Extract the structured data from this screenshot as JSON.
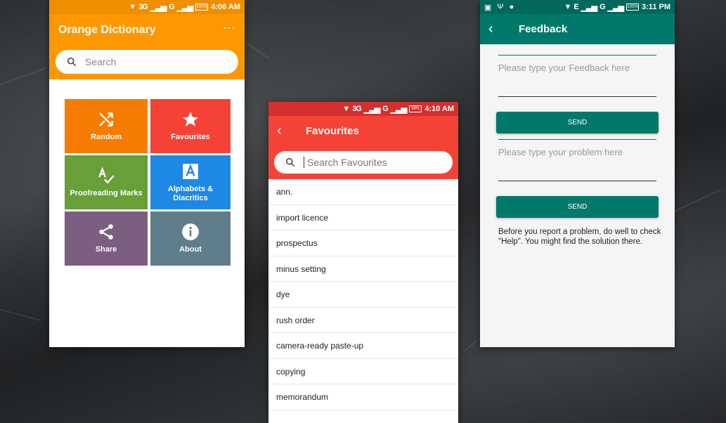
{
  "phone1": {
    "status": {
      "network": "3G",
      "network2": "G",
      "battery": "100%",
      "time": "4:06 AM"
    },
    "title": "Orange Dictionary",
    "search_placeholder": "Search",
    "tiles": [
      {
        "label": "Random",
        "color": "#f57c00",
        "icon": "shuffle-icon"
      },
      {
        "label": "Favourites",
        "color": "#f44336",
        "icon": "star-icon"
      },
      {
        "label": "Proofreading Marks",
        "color": "#689f38",
        "icon": "spellcheck-icon"
      },
      {
        "label": "Alphabets & Diacritics",
        "color": "#1e88e5",
        "icon": "letter-a-icon"
      },
      {
        "label": "Share",
        "color": "#7b5e80",
        "icon": "share-icon"
      },
      {
        "label": "About",
        "color": "#607d8b",
        "icon": "info-icon"
      }
    ]
  },
  "phone2": {
    "status": {
      "network": "3G",
      "network2": "G",
      "battery": "99%",
      "time": "4:10 AM"
    },
    "title": "Favourites",
    "search_placeholder": "Search Favourites",
    "items": [
      "ann.",
      "import licence",
      "prospectus",
      "minus setting",
      "dye",
      "rush order",
      "camera-ready paste-up",
      "copying",
      "memorandum"
    ]
  },
  "phone3": {
    "status": {
      "network": "E",
      "network2": "G",
      "battery": "100%",
      "time": "3:11 PM"
    },
    "title": "Feedback",
    "feedback_placeholder": "Please type your Feedback here",
    "problem_placeholder": "Please type your problem here",
    "send_label": "SEND",
    "send_label2": "SEND",
    "note": "Before you report a problem, do well to check \"Help\". You might find the solution there."
  },
  "colors": {
    "orange": "#ff9800",
    "red": "#f44336",
    "teal": "#00796b"
  }
}
